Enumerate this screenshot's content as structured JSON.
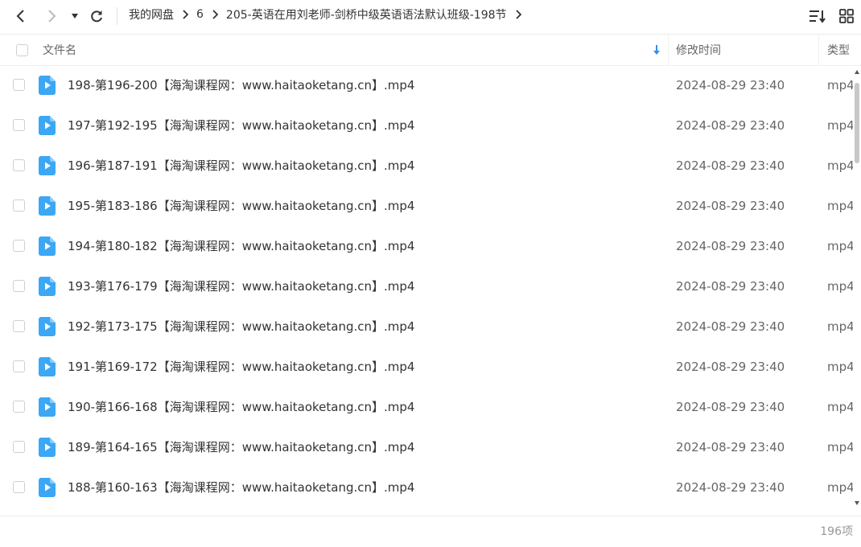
{
  "toolbar": {
    "breadcrumb": [
      "我的网盘",
      "6",
      "205-英语在用刘老师-剑桥中级英语语法默认班级-198节"
    ]
  },
  "columns": {
    "name": "文件名",
    "modified": "修改时间",
    "type": "类型"
  },
  "colors": {
    "file_icon": "#3ba7f5",
    "accent": "#2f8ff0"
  },
  "files": [
    {
      "name": "198-第196-200【海淘课程网：www.haitaoketang.cn】.mp4",
      "modified": "2024-08-29 23:40",
      "type": "mp4"
    },
    {
      "name": "197-第192-195【海淘课程网：www.haitaoketang.cn】.mp4",
      "modified": "2024-08-29 23:40",
      "type": "mp4"
    },
    {
      "name": "196-第187-191【海淘课程网：www.haitaoketang.cn】.mp4",
      "modified": "2024-08-29 23:40",
      "type": "mp4"
    },
    {
      "name": "195-第183-186【海淘课程网：www.haitaoketang.cn】.mp4",
      "modified": "2024-08-29 23:40",
      "type": "mp4"
    },
    {
      "name": "194-第180-182【海淘课程网：www.haitaoketang.cn】.mp4",
      "modified": "2024-08-29 23:40",
      "type": "mp4"
    },
    {
      "name": "193-第176-179【海淘课程网：www.haitaoketang.cn】.mp4",
      "modified": "2024-08-29 23:40",
      "type": "mp4"
    },
    {
      "name": "192-第173-175【海淘课程网：www.haitaoketang.cn】.mp4",
      "modified": "2024-08-29 23:40",
      "type": "mp4"
    },
    {
      "name": "191-第169-172【海淘课程网：www.haitaoketang.cn】.mp4",
      "modified": "2024-08-29 23:40",
      "type": "mp4"
    },
    {
      "name": "190-第166-168【海淘课程网：www.haitaoketang.cn】.mp4",
      "modified": "2024-08-29 23:40",
      "type": "mp4"
    },
    {
      "name": "189-第164-165【海淘课程网：www.haitaoketang.cn】.mp4",
      "modified": "2024-08-29 23:40",
      "type": "mp4"
    },
    {
      "name": "188-第160-163【海淘课程网：www.haitaoketang.cn】.mp4",
      "modified": "2024-08-29 23:40",
      "type": "mp4"
    }
  ],
  "footer": {
    "count": "196项"
  }
}
